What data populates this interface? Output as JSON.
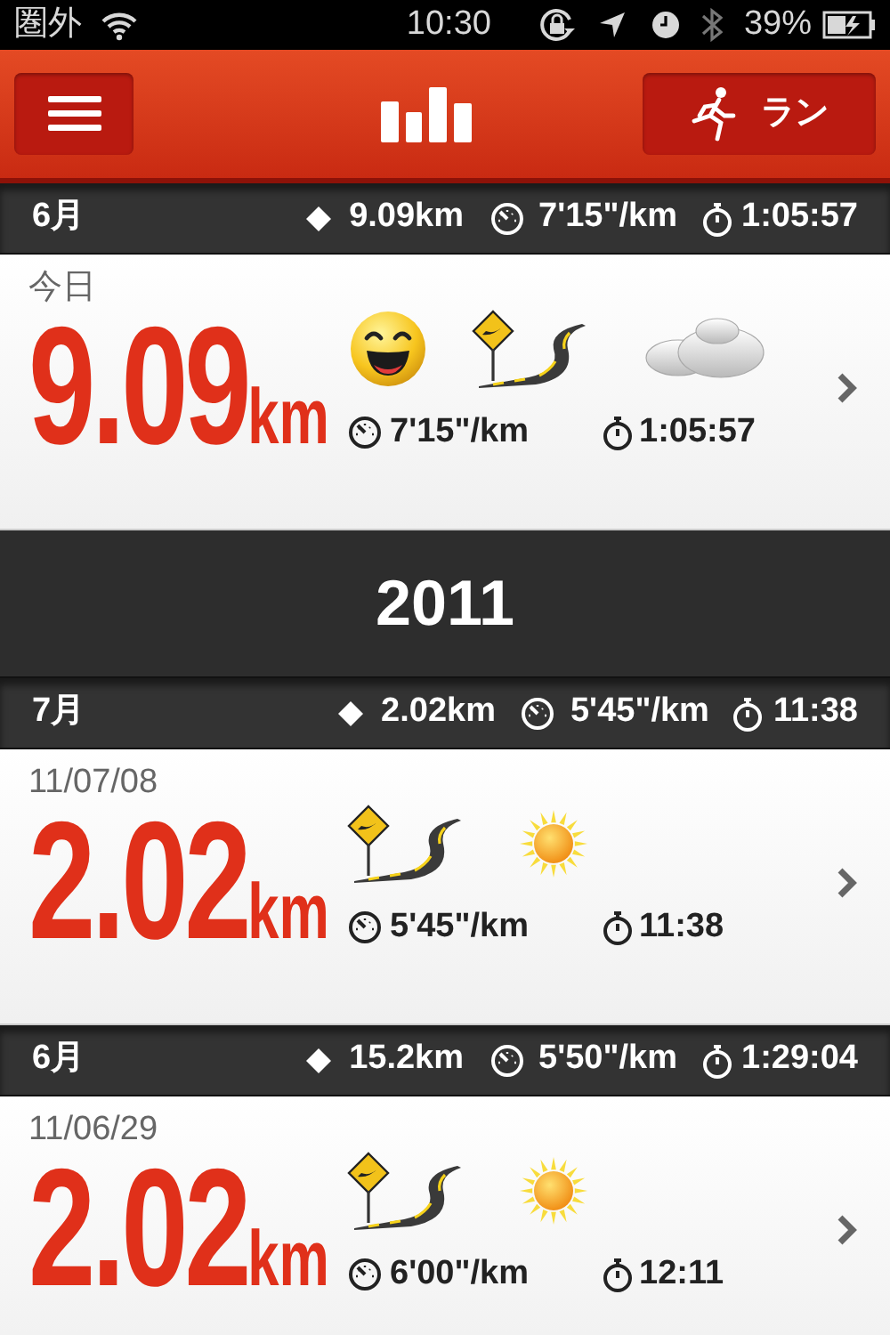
{
  "status_bar": {
    "carrier": "圏外",
    "time": "10:30",
    "battery": "39%"
  },
  "nav": {
    "run_button": "ラン"
  },
  "sections": [
    {
      "kind": "month",
      "label": "6月",
      "distance": "9.09km",
      "pace": "7'15\"/km",
      "duration": "1:05:57",
      "runs": [
        {
          "date": "今日",
          "distance": "9.09",
          "unit": "km",
          "pace": "7'15\"/km",
          "duration": "1:05:57",
          "conditions": [
            {
              "kind": "happy"
            },
            {
              "kind": "road"
            },
            {
              "kind": "cloudy"
            }
          ]
        }
      ]
    },
    {
      "kind": "year",
      "label": "2011"
    },
    {
      "kind": "month",
      "label": "7月",
      "distance": "2.02km",
      "pace": "5'45\"/km",
      "duration": "11:38",
      "runs": [
        {
          "date": "11/07/08",
          "distance": "2.02",
          "unit": "km",
          "pace": "5'45\"/km",
          "duration": "11:38",
          "conditions": [
            {
              "kind": "road"
            },
            {
              "kind": "sunny"
            }
          ]
        }
      ]
    },
    {
      "kind": "month",
      "label": "6月",
      "distance": "15.2km",
      "pace": "5'50\"/km",
      "duration": "1:29:04",
      "runs": [
        {
          "date": "11/06/29",
          "distance": "2.02",
          "unit": "km",
          "pace": "6'00\"/km",
          "duration": "12:11",
          "conditions": [
            {
              "kind": "road"
            },
            {
              "kind": "sunny"
            }
          ]
        }
      ]
    }
  ]
}
